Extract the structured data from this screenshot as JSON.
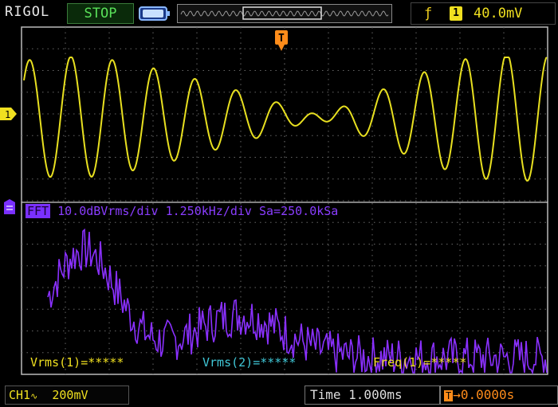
{
  "header": {
    "brand": "RIGOL",
    "run_state": "STOP",
    "trigger": {
      "channel": "1",
      "level": "40.0mV",
      "edge_icon": "rising-edge-icon"
    }
  },
  "markers": {
    "ch1": "1",
    "trigger_flag": "T"
  },
  "fft": {
    "badge": "FFT",
    "info": "10.0dBVrms/div 1.250kHz/div Sa=250.0kSa"
  },
  "measurements": {
    "vrms1": "Vrms(1)=*****",
    "vrms2": "Vrms(2)=*****",
    "freq1": "Freq(1)=*****"
  },
  "footer": {
    "ch1_label": "CH1",
    "ch1_scale": "200mV",
    "timebase": "Time 1.000ms",
    "trigger_offset": "0.0000s"
  },
  "colors": {
    "ch1": "#f0e020",
    "fft": "#8a3dff",
    "trigger": "#ff8c1a",
    "run_state": "#59e059",
    "vrms2": "#40c8d8"
  }
}
